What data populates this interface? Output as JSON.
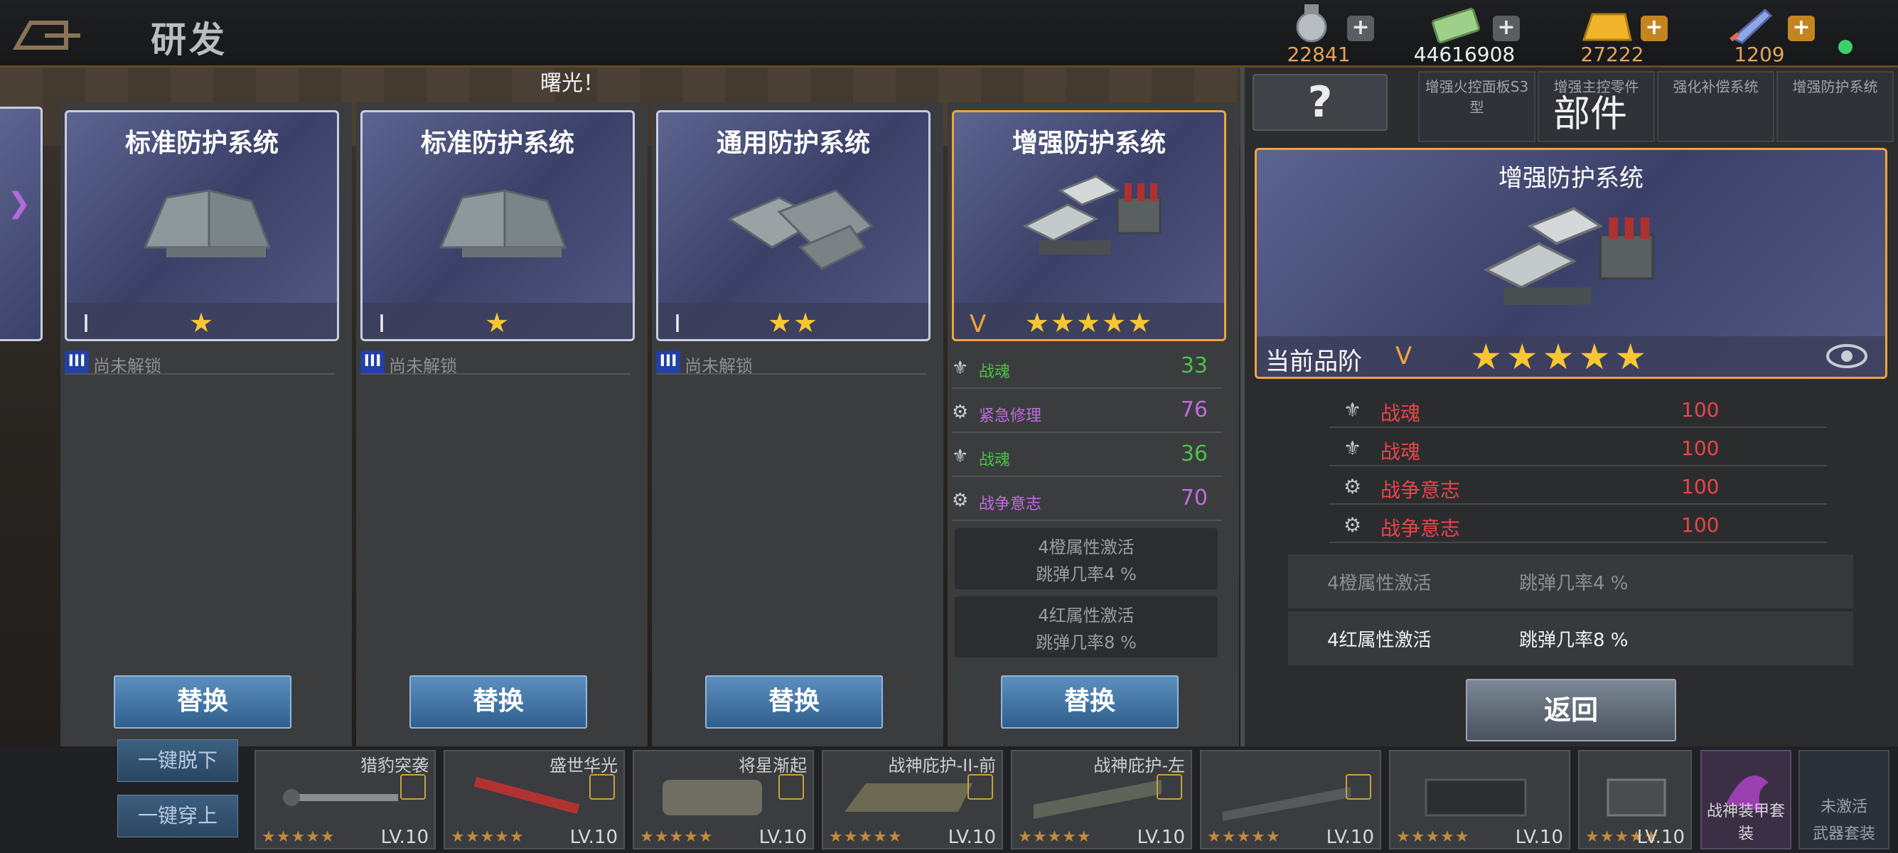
{
  "header": {
    "title": "研发",
    "resources": [
      {
        "icon": "medal-icon",
        "value": "22841"
      },
      {
        "icon": "cash-icon",
        "value": "44616908"
      },
      {
        "icon": "gold-bar-icon",
        "value": "27222"
      },
      {
        "icon": "rocket-icon",
        "value": "1209"
      }
    ],
    "plus": "+"
  },
  "background": {
    "notice": "曙光！"
  },
  "cards": [
    {
      "name": "标准防护系统",
      "tier": "I",
      "stars": "★",
      "locked_label": "尚未解锁",
      "lock_tier": "III",
      "swap": "替换"
    },
    {
      "name": "标准防护系统",
      "tier": "I",
      "stars": "★",
      "locked_label": "尚未解锁",
      "lock_tier": "III",
      "swap": "替换"
    },
    {
      "name": "通用防护系统",
      "tier": "I",
      "stars": "★★",
      "locked_label": "尚未解锁",
      "lock_tier": "III",
      "swap": "替换"
    },
    {
      "name": "增强防护系统",
      "tier": "V",
      "stars": "★★★★★",
      "swap": "替换",
      "attrs": [
        {
          "name": "战魂",
          "value": "33",
          "color": "#4cc04a"
        },
        {
          "name": "紧急修理",
          "value": "76",
          "color": "#c06be0"
        },
        {
          "name": "战魂",
          "value": "36",
          "color": "#4cc04a"
        },
        {
          "name": "战争意志",
          "value": "70",
          "color": "#c06be0"
        }
      ],
      "sets": [
        {
          "line1": "4橙属性激活",
          "line2": "跳弹几率4 %"
        },
        {
          "line1": "4红属性激活",
          "line2": "跳弹几率8 %"
        }
      ]
    }
  ],
  "detail": {
    "help": "?",
    "title": "部件",
    "chips": [
      "增强火控面板S3型",
      "增强主控零件",
      "强化补偿系统",
      "增强防护系统"
    ],
    "card_name": "增强防护系统",
    "grade_label": "当前品阶",
    "grade": "V",
    "stars": "★★★★★",
    "attrs": [
      {
        "name": "战魂",
        "value": "100"
      },
      {
        "name": "战魂",
        "value": "100"
      },
      {
        "name": "战争意志",
        "value": "100"
      },
      {
        "name": "战争意志",
        "value": "100"
      }
    ],
    "sets": [
      {
        "key": "4橙属性激活",
        "value": "跳弹几率4 %",
        "active": false
      },
      {
        "key": "4红属性激活",
        "value": "跳弹几率8 %",
        "active": true
      }
    ],
    "return": "返回"
  },
  "bottom": {
    "unequip_all": "一键脱下",
    "equip_all": "一键穿上",
    "items": [
      {
        "name": "猎豹突袭",
        "stars": "★★★★★",
        "lv": "LV.10"
      },
      {
        "name": "盛世华光",
        "stars": "★★★★★",
        "lv": "LV.10"
      },
      {
        "name": "将星渐起",
        "stars": "★★★★★",
        "lv": "LV.10"
      },
      {
        "name": "战神庇护-II-前",
        "stars": "★★★★★",
        "lv": "LV.10"
      },
      {
        "name": "战神庇护-左",
        "stars": "★★★★★",
        "lv": "LV.10"
      },
      {
        "name": "",
        "stars": "★★★★★",
        "lv": "LV.10"
      },
      {
        "name": "",
        "stars": "★★★★★",
        "lv": "LV.10"
      },
      {
        "name": "",
        "stars": "★★★★★",
        "lv": "LV.10"
      }
    ],
    "suit1": "战神装甲套装",
    "suit2_top": "未激活",
    "suit2": "武器套装"
  }
}
